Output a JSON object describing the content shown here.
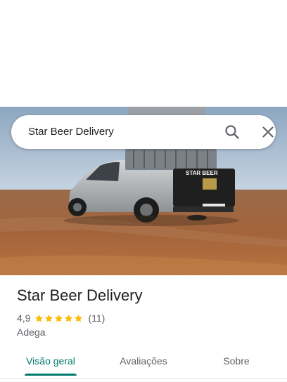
{
  "search": {
    "query": "Star Beer Delivery",
    "search_icon": "search-icon",
    "close_icon": "close-icon"
  },
  "place": {
    "name": "Star Beer Delivery",
    "rating": "4,9",
    "stars": 5,
    "review_count": "(11)",
    "category": "Adega",
    "photo_sign": "STAR BEER"
  },
  "tabs": [
    {
      "label": "Visão geral",
      "active": true
    },
    {
      "label": "Avaliações",
      "active": false
    },
    {
      "label": "Sobre",
      "active": false
    }
  ],
  "colors": {
    "accent": "#00796b",
    "star": "#fbbc04",
    "text_primary": "#202124",
    "text_secondary": "#5f6368"
  }
}
